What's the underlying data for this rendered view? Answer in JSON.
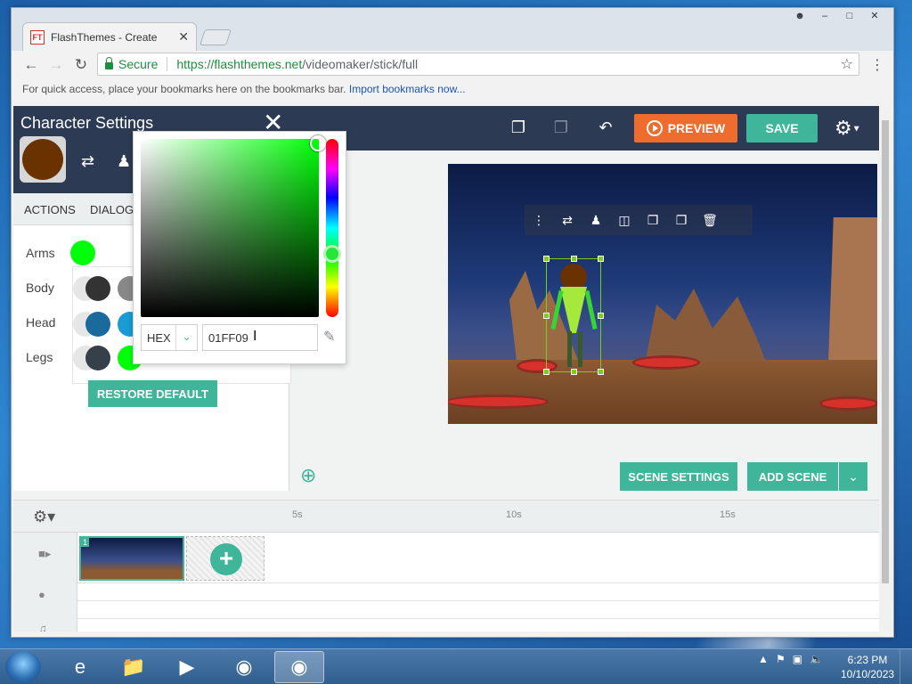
{
  "browser": {
    "tab_title": "FlashThemes - Create",
    "tab_favicon": "FT",
    "secure_label": "Secure",
    "url_scheme_host": "https://flashthemes.net",
    "url_path": "/videomaker/stick/full",
    "bookmarks_text": "For quick access, place your bookmarks here on the bookmarks bar.",
    "bookmarks_link": "Import bookmarks now..."
  },
  "app": {
    "preview_label": "PREVIEW",
    "save_label": "SAVE",
    "scene_settings_label": "SCENE SETTINGS",
    "add_scene_label": "ADD SCENE"
  },
  "character_settings": {
    "title": "Character Settings",
    "tabs": [
      "ACTIONS",
      "DIALOG"
    ],
    "parts": [
      {
        "label": "Arms",
        "color": "#01FF09"
      },
      {
        "label": "Body"
      },
      {
        "label": "Head"
      },
      {
        "label": "Legs"
      }
    ],
    "restore_label": "RESTORE DEFAULT",
    "avatar_color": "#6a3200"
  },
  "color_picker": {
    "mode": "HEX",
    "value": "01FF09"
  },
  "timeline": {
    "marks": [
      "5s",
      "10s",
      "15s"
    ],
    "scene_number": "1"
  },
  "taskbar": {
    "time": "6:23 PM",
    "date": "10/10/2023"
  },
  "colors": {
    "accent": "#3fb59a",
    "preview": "#ef6c2f",
    "header": "#2c3a53"
  }
}
